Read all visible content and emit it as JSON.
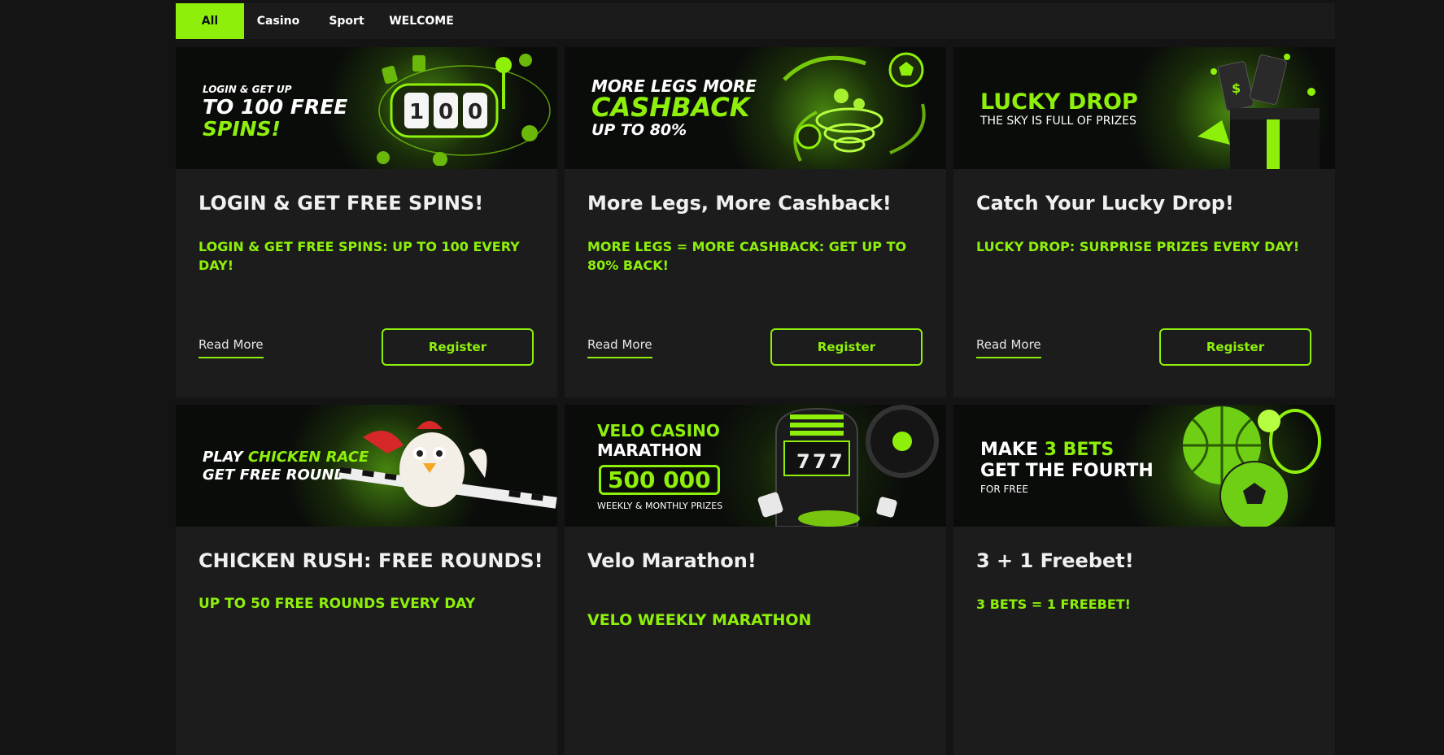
{
  "tabs": [
    {
      "label": "All"
    },
    {
      "label": "Casino"
    },
    {
      "label": "Sport"
    },
    {
      "label": "WELCOME"
    }
  ],
  "cards": [
    {
      "banner_line1": "LOGIN & GET UP",
      "banner_line2": "TO 100 FREE",
      "banner_line3": "SPINS!",
      "reel_digits": "100",
      "title": "LOGIN & GET FREE SPINS!",
      "subtitle": "LOGIN & GET FREE SPINS: UP TO 100 EVERY DAY!",
      "read_more": "Read More",
      "register": "Register"
    },
    {
      "banner_line1": "MORE LEGS MORE",
      "banner_line2": "CASHBACK",
      "banner_line3": "UP TO 80%",
      "title": "More Legs, More Cashback!",
      "subtitle": "MORE LEGS = MORE CASHBACK: GET UP TO 80% BACK!",
      "read_more": "Read More",
      "register": "Register"
    },
    {
      "banner_line1": "LUCKY DROP",
      "banner_line2": "THE SKY IS FULL OF PRIZES",
      "title": "Catch Your Lucky Drop!",
      "subtitle": "LUCKY DROP: SURPRISE PRIZES EVERY DAY!",
      "read_more": "Read More",
      "register": "Register"
    },
    {
      "banner_line1a": "PLAY ",
      "banner_line1b": "CHICKEN RACE",
      "banner_line2": "GET FREE ROUNDS",
      "title": "CHICKEN RUSH: FREE ROUNDS!",
      "subtitle": "UP TO 50 FREE ROUNDS EVERY DAY"
    },
    {
      "banner_line1": "VELO CASINO",
      "banner_line2": "MARATHON",
      "banner_amount": "500 000",
      "banner_line3": "WEEKLY & MONTHLY PRIZES",
      "slot_digits": "777",
      "title": "Velo Marathon!",
      "subtitle": "VELO WEEKLY MARATHON"
    },
    {
      "banner_line1a": "MAKE ",
      "banner_line1b": "3 BETS",
      "banner_line2": "GET THE FOURTH",
      "banner_line3": "FOR FREE",
      "title": "3 + 1 Freebet!",
      "subtitle": "3 BETS = 1 FREEBET!"
    }
  ],
  "colors": {
    "accent": "#8ef00a",
    "background": "#141414",
    "card": "#1c1c1c"
  }
}
